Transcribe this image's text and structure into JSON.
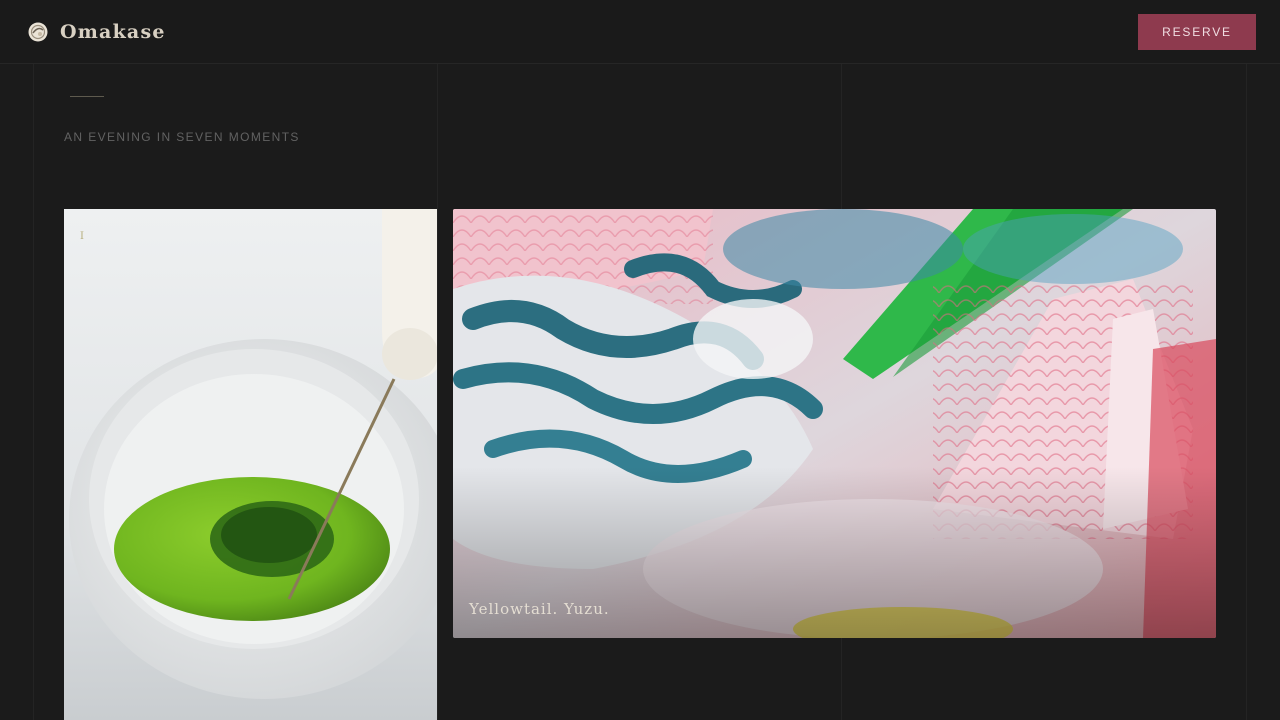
{
  "header": {
    "logo_icon": "plate-icon",
    "brand": "Omakase",
    "reserve_label": "RESERVE"
  },
  "intro": {
    "tagline": "AN EVENING IN SEVEN MOMENTS"
  },
  "courses": [
    {
      "index": "I",
      "image": "matcha tea bowl with whisk"
    },
    {
      "caption": "Yellowtail. Yuzu.",
      "image": "sashimi platter with seaweed"
    }
  ],
  "colors": {
    "background": "#1b1b1b",
    "accent": "#8e3a4e",
    "brand_text": "#d8d0c2"
  }
}
